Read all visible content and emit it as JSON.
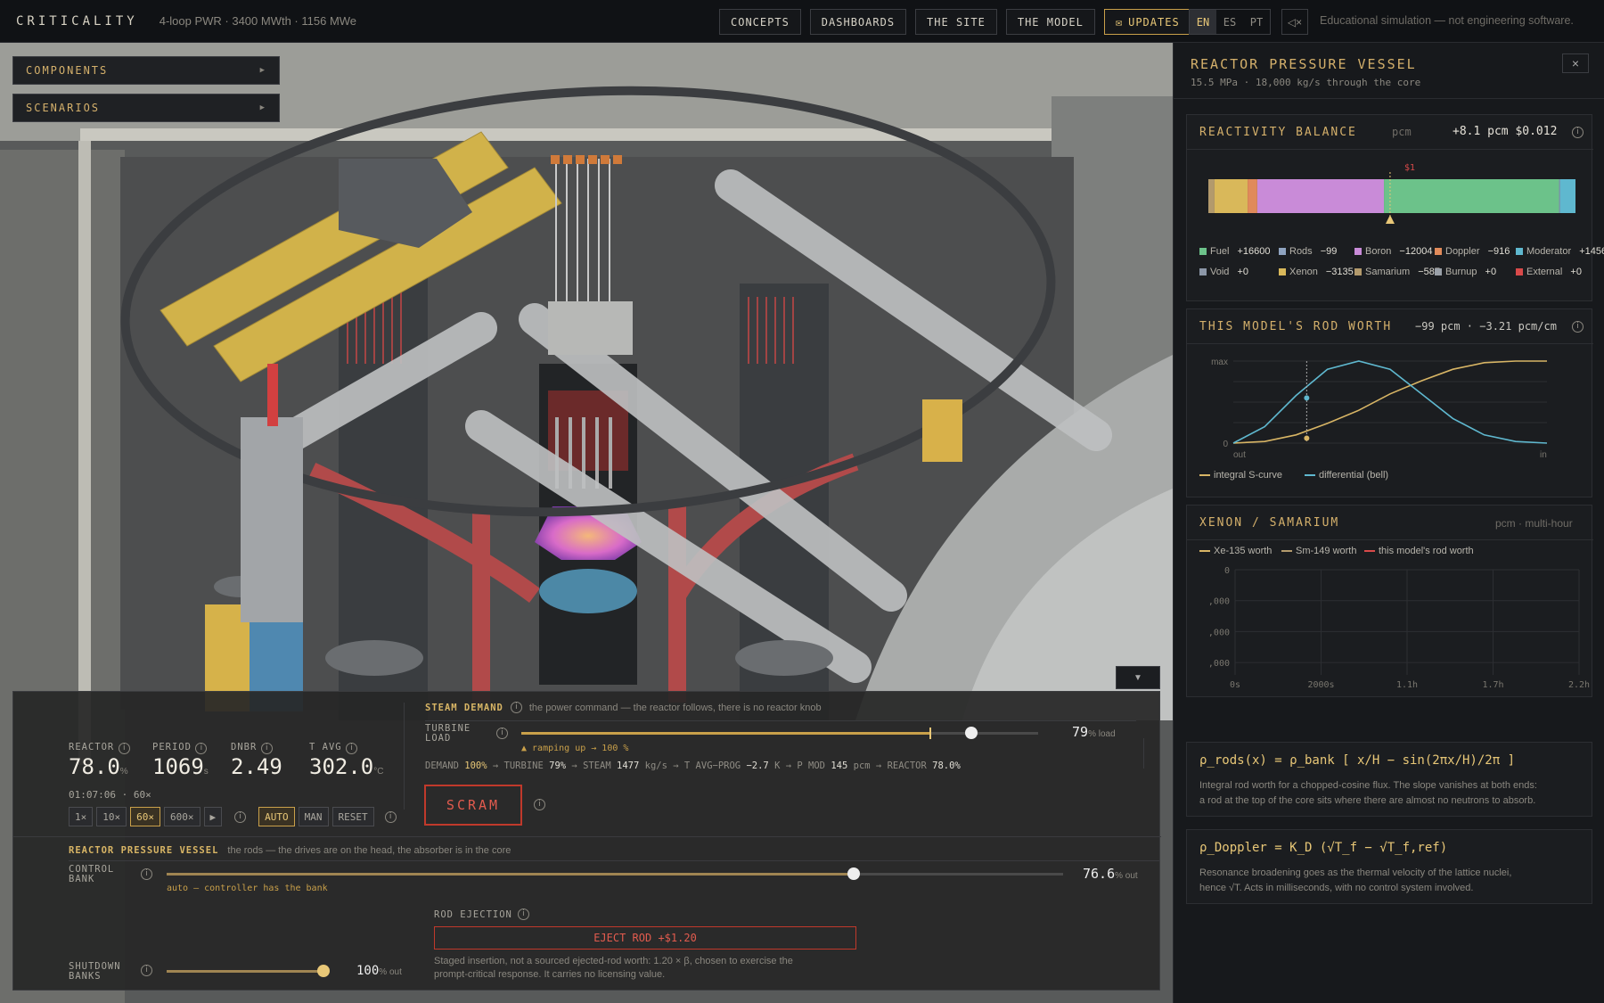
{
  "header": {
    "brand": "CRITICALITY",
    "subtitle": "4-loop PWR · 3400 MWth · 1156 MWe",
    "nav": [
      "CONCEPTS",
      "DASHBOARDS",
      "THE SITE",
      "THE MODEL"
    ],
    "updates": "UPDATES",
    "langs": [
      "EN",
      "ES",
      "PT"
    ],
    "disclaimer": "Educational simulation — not engineering software."
  },
  "sidebar": {
    "components": "COMPONENTS",
    "scenarios": "SCENARIOS"
  },
  "readouts": [
    {
      "label": "REACTOR",
      "value": "78.0",
      "unit": "%"
    },
    {
      "label": "PERIOD",
      "value": "1069",
      "unit": "s"
    },
    {
      "label": "DNBR",
      "value": "2.49",
      "unit": ""
    },
    {
      "label": "T AVG",
      "value": "302.0",
      "unit": "°C"
    }
  ],
  "clock": "01:07:06 · 60×",
  "speeds": [
    "1×",
    "10×",
    "60×",
    "600×"
  ],
  "speed_active": "60×",
  "modes": [
    "AUTO",
    "MAN",
    "RESET"
  ],
  "steam": {
    "title": "STEAM DEMAND",
    "desc": "the power command — the reactor follows, there is no reactor knob",
    "turbine_label1": "TURBINE",
    "turbine_label2": "LOAD",
    "ramp": "▲ ramping up → 100 %",
    "value": "79",
    "unit": "% load",
    "fraction": 0.79,
    "target": 0.79
  },
  "demand_line": {
    "demand": "DEMAND",
    "demand_v": "100%",
    "turbine": "→ TURBINE",
    "turbine_v": "79%",
    "steam": "→ STEAM",
    "steam_v": "1477",
    "steam_u": "kg/s",
    "tavg": "→ T AVG−PROG",
    "tavg_v": "−2.7",
    "tavg_u": "K",
    "pmod": "→ P MOD",
    "pmod_v": "145",
    "pmod_u": "pcm",
    "reactor": "→ REACTOR",
    "reactor_v": "78.0%"
  },
  "scram": "SCRAM",
  "rpv": {
    "title": "REACTOR PRESSURE VESSEL",
    "desc": "the rods — the drives are on the head, the absorber is in the core",
    "bank1": "CONTROL",
    "bank2": "BANK",
    "bank_value": "76.6",
    "bank_unit": "% out",
    "bank_fraction": 0.766,
    "auto_note": "auto — controller has the bank",
    "shut1": "SHUTDOWN",
    "shut2": "BANKS",
    "shut_value": "100",
    "shut_unit": "% out",
    "shut_fraction": 1.0
  },
  "ejection": {
    "title": "ROD EJECTION",
    "button": "EJECT ROD +$1.20",
    "note1": "Staged insertion, not a sourced ejected-rod worth: 1.20 × β, chosen to exercise the",
    "note2": "prompt-critical response. It carries no licensing value."
  },
  "panel": {
    "title": "REACTOR PRESSURE VESSEL",
    "subtitle": "15.5 MPa · 18,000 kg/s through the core",
    "close": "×"
  },
  "reactivity": {
    "title": "REACTIVITY BALANCE",
    "unit": "pcm",
    "value": "+8.1 pcm $0.012",
    "marker": "$1",
    "legend": [
      {
        "name": "Fuel",
        "value": "+16600",
        "color": "#6cc28a"
      },
      {
        "name": "Rods",
        "value": "−99",
        "color": "#8fa3c0"
      },
      {
        "name": "Boron",
        "value": "−12004",
        "color": "#c98bd8"
      },
      {
        "name": "Doppler",
        "value": "−916",
        "color": "#e08a5a"
      },
      {
        "name": "Moderator",
        "value": "+1456",
        "color": "#5fb8cf"
      },
      {
        "name": "Void",
        "value": "+0",
        "color": "#8c97a8"
      },
      {
        "name": "Xenon",
        "value": "−3135",
        "color": "#d9b85a"
      },
      {
        "name": "Samarium",
        "value": "−587",
        "color": "#b39a6c"
      },
      {
        "name": "Burnup",
        "value": "+0",
        "color": "#9aa0a8"
      },
      {
        "name": "External",
        "value": "+0",
        "color": "#d94a4a"
      }
    ]
  },
  "rodworth": {
    "title": "THIS MODEL'S ROD WORTH",
    "value": "−99 pcm · −3.21 pcm/cm",
    "y_max": "max",
    "y_zero": "0",
    "x_out": "out",
    "x_in": "in",
    "legend_int": "integral S-curve",
    "legend_diff": "differential (bell)",
    "position": 0.234
  },
  "xenon": {
    "title": "XENON / SAMARIUM",
    "unit": "pcm · multi-hour",
    "legend": [
      "Xe-135 worth",
      "Sm-149 worth",
      "this model's rod worth"
    ],
    "y_ticks": [
      "0",
      ",000",
      ",000",
      ",000"
    ],
    "x_ticks": [
      "0s",
      "2000s",
      "1.1h",
      "1.7h",
      "2.2h"
    ]
  },
  "formula1": {
    "eq": "ρ_rods(x) = ρ_bank [ x/H − sin(2πx/H)/2π ]",
    "d1": "Integral rod worth for a chopped-cosine flux. The slope vanishes at both ends:",
    "d2": "a rod at the top of the core sits where there are almost no neutrons to absorb."
  },
  "formula2": {
    "eq": "ρ_Doppler = K_D (√T_f − √T_f,ref)",
    "d1": "Resonance broadening goes as the thermal velocity of the lattice nuclei,",
    "d2": "hence √T. Acts in milliseconds, with no control system involved."
  },
  "chart_data": [
    {
      "type": "bar",
      "title": "REACTIVITY BALANCE",
      "stacked": true,
      "unit": "pcm",
      "categories": [
        "Fuel",
        "Rods",
        "Boron",
        "Doppler",
        "Moderator",
        "Void",
        "Xenon",
        "Samarium",
        "Burnup",
        "External"
      ],
      "values": [
        16600,
        -99,
        -12004,
        -916,
        1456,
        0,
        -3135,
        -587,
        0,
        0
      ],
      "net": 8.1
    },
    {
      "type": "line",
      "title": "THIS MODEL'S ROD WORTH",
      "x": [
        0,
        0.1,
        0.2,
        0.3,
        0.4,
        0.5,
        0.6,
        0.7,
        0.8,
        0.9,
        1.0
      ],
      "series": [
        {
          "name": "integral S-curve",
          "values": [
            0,
            0.02,
            0.1,
            0.24,
            0.4,
            0.6,
            0.76,
            0.9,
            0.98,
            1.0,
            1.0
          ]
        },
        {
          "name": "differential (bell)",
          "values": [
            0,
            0.2,
            0.58,
            0.9,
            1.0,
            0.9,
            0.6,
            0.3,
            0.1,
            0.02,
            0
          ]
        }
      ],
      "marker_x": 0.234
    },
    {
      "type": "line",
      "title": "XENON / SAMARIUM",
      "series": [
        {
          "name": "Xe-135 worth",
          "values": []
        },
        {
          "name": "Sm-149 worth",
          "values": []
        },
        {
          "name": "this model's rod worth",
          "values": []
        }
      ],
      "x_ticks": [
        "0s",
        "2000s",
        "1.1h",
        "1.7h",
        "2.2h"
      ]
    }
  ]
}
